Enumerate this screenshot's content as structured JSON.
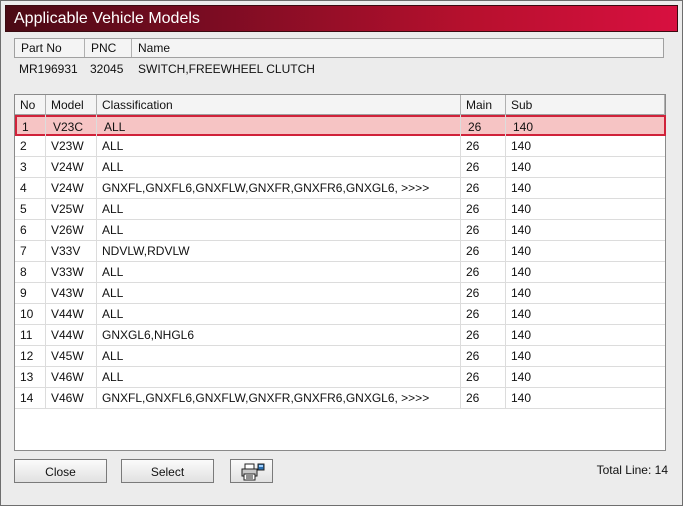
{
  "window": {
    "title": "Applicable Vehicle Models"
  },
  "part_info": {
    "headers": {
      "part_no": "Part No",
      "pnc": "PNC",
      "name": "Name"
    },
    "values": {
      "part_no": "MR196931",
      "pnc": "32045",
      "name": "SWITCH,FREEWHEEL CLUTCH"
    }
  },
  "table": {
    "columns": [
      "No",
      "Model",
      "Classification",
      "Main",
      "Sub"
    ],
    "selected_index": 0,
    "rows": [
      {
        "no": "1",
        "model": "V23C",
        "classification": "ALL",
        "main": "26",
        "sub": "140"
      },
      {
        "no": "2",
        "model": "V23W",
        "classification": "ALL",
        "main": "26",
        "sub": "140"
      },
      {
        "no": "3",
        "model": "V24W",
        "classification": "ALL",
        "main": "26",
        "sub": "140"
      },
      {
        "no": "4",
        "model": "V24W",
        "classification": "GNXFL,GNXFL6,GNXFLW,GNXFR,GNXFR6,GNXGL6,  >>>>",
        "main": "26",
        "sub": "140"
      },
      {
        "no": "5",
        "model": "V25W",
        "classification": "ALL",
        "main": "26",
        "sub": "140"
      },
      {
        "no": "6",
        "model": "V26W",
        "classification": "ALL",
        "main": "26",
        "sub": "140"
      },
      {
        "no": "7",
        "model": "V33V",
        "classification": "NDVLW,RDVLW",
        "main": "26",
        "sub": "140"
      },
      {
        "no": "8",
        "model": "V33W",
        "classification": "ALL",
        "main": "26",
        "sub": "140"
      },
      {
        "no": "9",
        "model": "V43W",
        "classification": "ALL",
        "main": "26",
        "sub": "140"
      },
      {
        "no": "10",
        "model": "V44W",
        "classification": "ALL",
        "main": "26",
        "sub": "140"
      },
      {
        "no": "11",
        "model": "V44W",
        "classification": "GNXGL6,NHGL6",
        "main": "26",
        "sub": "140"
      },
      {
        "no": "12",
        "model": "V45W",
        "classification": "ALL",
        "main": "26",
        "sub": "140"
      },
      {
        "no": "13",
        "model": "V46W",
        "classification": "ALL",
        "main": "26",
        "sub": "140"
      },
      {
        "no": "14",
        "model": "V46W",
        "classification": "GNXFL,GNXFL6,GNXFLW,GNXFR,GNXFR6,GNXGL6,  >>>>",
        "main": "26",
        "sub": "140"
      }
    ]
  },
  "footer": {
    "close_label": "Close",
    "select_label": "Select",
    "print_icon": "printer-icon",
    "total_label": "Total Line: 14"
  },
  "colors": {
    "title_start": "#4a0a14",
    "title_end": "#d81040",
    "selected_bg": "#f6c4c4",
    "selected_border": "#d0223a"
  }
}
